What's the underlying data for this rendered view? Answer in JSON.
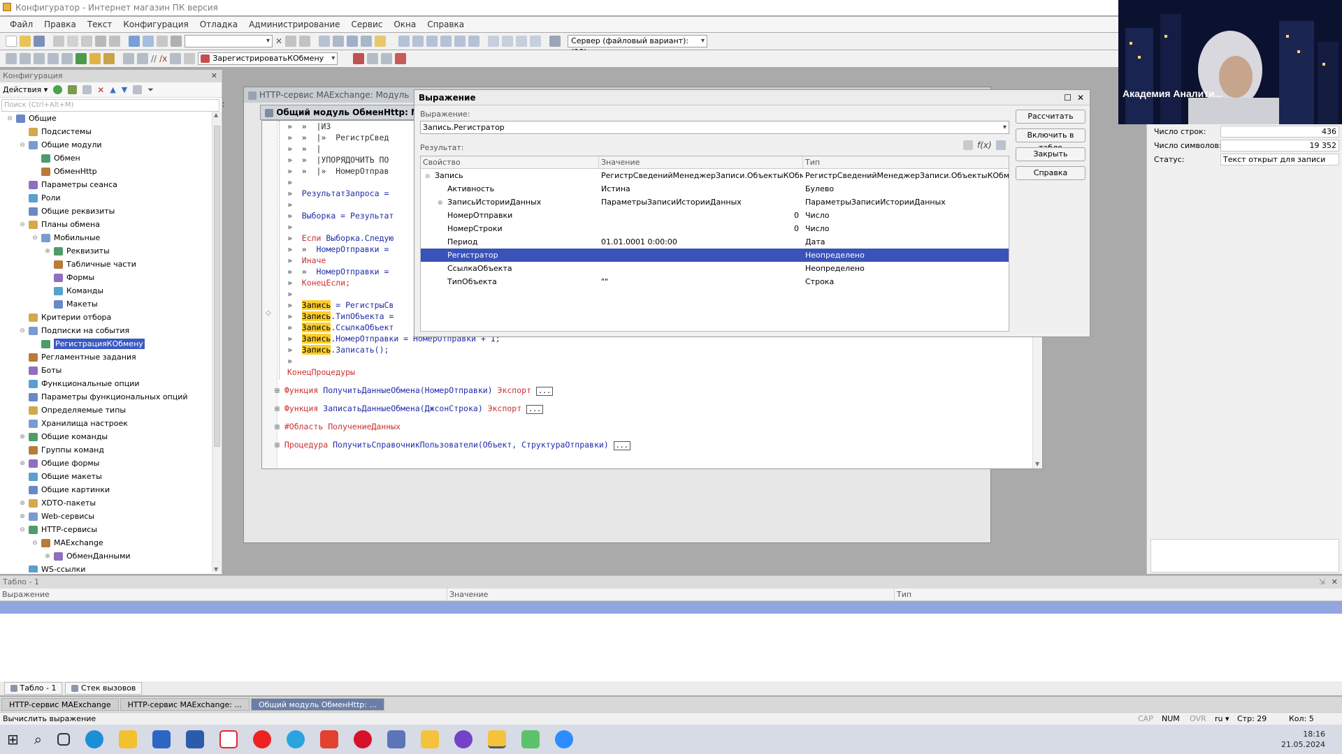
{
  "app": {
    "title": "Конфигуратор - Интернет магазин ПК версия",
    "menu": [
      "Файл",
      "Правка",
      "Текст",
      "Конфигурация",
      "Отладка",
      "Администрирование",
      "Сервис",
      "Окна",
      "Справка"
    ],
    "server_combo": "Сервер (файловый вариант): (10)",
    "proc_combo": "ЗарегистрироватьКОбмену"
  },
  "config_panel": {
    "title": "Конфигурация",
    "actions_label": "Действия",
    "search_placeholder": "Поиск (Ctrl+Alt+M)",
    "tree": [
      {
        "label": "Общие",
        "level": 0,
        "twisty": "⊖"
      },
      {
        "label": "Подсистемы",
        "level": 1,
        "twisty": ""
      },
      {
        "label": "Общие модули",
        "level": 1,
        "twisty": "⊖"
      },
      {
        "label": "Обмен",
        "level": 2,
        "twisty": ""
      },
      {
        "label": "ОбменHttp",
        "level": 2,
        "twisty": ""
      },
      {
        "label": "Параметры сеанса",
        "level": 1,
        "twisty": ""
      },
      {
        "label": "Роли",
        "level": 1,
        "twisty": ""
      },
      {
        "label": "Общие реквизиты",
        "level": 1,
        "twisty": ""
      },
      {
        "label": "Планы обмена",
        "level": 1,
        "twisty": "⊖"
      },
      {
        "label": "Мобильные",
        "level": 2,
        "twisty": "⊖"
      },
      {
        "label": "Реквизиты",
        "level": 3,
        "twisty": "⊕"
      },
      {
        "label": "Табличные части",
        "level": 3,
        "twisty": ""
      },
      {
        "label": "Формы",
        "level": 3,
        "twisty": ""
      },
      {
        "label": "Команды",
        "level": 3,
        "twisty": ""
      },
      {
        "label": "Макеты",
        "level": 3,
        "twisty": ""
      },
      {
        "label": "Критерии отбора",
        "level": 1,
        "twisty": ""
      },
      {
        "label": "Подписки на события",
        "level": 1,
        "twisty": "⊖"
      },
      {
        "label": "РегистрацияКОбмену",
        "level": 2,
        "twisty": "",
        "selected": true
      },
      {
        "label": "Регламентные задания",
        "level": 1,
        "twisty": ""
      },
      {
        "label": "Боты",
        "level": 1,
        "twisty": ""
      },
      {
        "label": "Функциональные опции",
        "level": 1,
        "twisty": ""
      },
      {
        "label": "Параметры функциональных опций",
        "level": 1,
        "twisty": ""
      },
      {
        "label": "Определяемые типы",
        "level": 1,
        "twisty": ""
      },
      {
        "label": "Хранилища настроек",
        "level": 1,
        "twisty": ""
      },
      {
        "label": "Общие команды",
        "level": 1,
        "twisty": "⊕"
      },
      {
        "label": "Группы команд",
        "level": 1,
        "twisty": ""
      },
      {
        "label": "Общие формы",
        "level": 1,
        "twisty": "⊕"
      },
      {
        "label": "Общие макеты",
        "level": 1,
        "twisty": ""
      },
      {
        "label": "Общие картинки",
        "level": 1,
        "twisty": ""
      },
      {
        "label": "XDTO-пакеты",
        "level": 1,
        "twisty": "⊕"
      },
      {
        "label": "Web-сервисы",
        "level": 1,
        "twisty": "⊕"
      },
      {
        "label": "HTTP-сервисы",
        "level": 1,
        "twisty": "⊖"
      },
      {
        "label": "MAExchange",
        "level": 2,
        "twisty": "⊖"
      },
      {
        "label": "ОбменДанными",
        "level": 3,
        "twisty": "⊕"
      },
      {
        "label": "WS-ссылки",
        "level": 1,
        "twisty": ""
      }
    ]
  },
  "bg_window_title": "HTTP-сервис MAExchange: Модуль",
  "module_window_title": "Общий модуль ОбменHttp: Модул",
  "code_lines": [
    [
      {
        "t": "»  »  |ИЗ",
        "c": "cg"
      }
    ],
    [
      {
        "t": "»  »  |»  РегистрСвед",
        "c": "cg"
      }
    ],
    [
      {
        "t": "»  »  |",
        "c": "cg"
      }
    ],
    [
      {
        "t": "»  »  |УПОРЯДОЧИТЬ ПО",
        "c": "cg"
      }
    ],
    [
      {
        "t": "»  »  |»  НомерОтправ",
        "c": "cg"
      }
    ],
    [
      {
        "t": "»",
        "c": "cg"
      }
    ],
    [
      {
        "t": "»  ",
        "c": "cg"
      },
      {
        "t": "РезультатЗапроса = ",
        "c": "id"
      }
    ],
    [
      {
        "t": "»",
        "c": "cg"
      }
    ],
    [
      {
        "t": "»  ",
        "c": "cg"
      },
      {
        "t": "Выборка = Результат",
        "c": "id"
      }
    ],
    [
      {
        "t": "»",
        "c": "cg"
      }
    ],
    [
      {
        "t": "»  ",
        "c": "cg"
      },
      {
        "t": "Если",
        "c": "kw"
      },
      {
        "t": " Выборка.Следую",
        "c": "id"
      }
    ],
    [
      {
        "t": "»  »  ",
        "c": "cg"
      },
      {
        "t": "НомерОтправки =",
        "c": "id"
      }
    ],
    [
      {
        "t": "»  ",
        "c": "cg"
      },
      {
        "t": "Иначе",
        "c": "kw"
      }
    ],
    [
      {
        "t": "»  »  ",
        "c": "cg"
      },
      {
        "t": "НомерОтправки =",
        "c": "id"
      }
    ],
    [
      {
        "t": "»  ",
        "c": "cg"
      },
      {
        "t": "КонецЕсли;",
        "c": "kw"
      }
    ],
    [
      {
        "t": "»",
        "c": "cg"
      }
    ],
    [
      {
        "t": "»  ",
        "c": "cg"
      },
      {
        "t": "Запись",
        "c": "hl"
      },
      {
        "t": " = РегистрыСв",
        "c": "id"
      }
    ],
    [
      {
        "t": "»  ",
        "c": "cg"
      },
      {
        "t": "Запись",
        "c": "hl"
      },
      {
        "t": ".ТипОбъекта =",
        "c": "id"
      }
    ],
    [
      {
        "t": "»  ",
        "c": "cg"
      },
      {
        "t": "Запись",
        "c": "hl"
      },
      {
        "t": ".СсылкаОбъект",
        "c": "id"
      }
    ],
    [
      {
        "t": "»  ",
        "c": "cg"
      },
      {
        "t": "Запись",
        "c": "hl"
      },
      {
        "t": ".НомерОтправки = НомерОтправки + 1;",
        "c": "id"
      }
    ],
    [
      {
        "t": "»  ",
        "c": "cg"
      },
      {
        "t": "Запись",
        "c": "hl"
      },
      {
        "t": ".Записать();",
        "c": "id"
      }
    ],
    [
      {
        "t": "»",
        "c": "cg"
      }
    ],
    [
      {
        "t": "КонецПроцедуры",
        "c": "kw"
      }
    ]
  ],
  "code_functions": [
    {
      "kw": "Функция",
      "sig": "ПолучитьДанныеОбмена(НомерОтправки)",
      "ex": "Экспорт",
      "box": "..."
    },
    {
      "kw": "Функция",
      "sig": "ЗаписатьДанныеОбмена(ДжсонСтрока)",
      "ex": "Экспорт",
      "box": "..."
    },
    {
      "kw": "#Область",
      "sig": "ПолучениеДанных",
      "ex": "",
      "box": ""
    },
    {
      "kw": "Процедура",
      "sig": "ПолучитьСправочникПользователи(Объект, СтруктураОтправки)",
      "ex": "",
      "box": "..."
    }
  ],
  "expression_dialog": {
    "title": "Выражение",
    "expr_label": "Выражение:",
    "expr_value": "Запись.Регистратор",
    "result_label": "Результат:",
    "buttons": [
      "Рассчитать",
      "Включить в табло",
      "Закрыть",
      "Справка"
    ],
    "columns": [
      "Свойство",
      "Значение",
      "Тип"
    ],
    "rows": [
      {
        "prop": "Запись",
        "val": "РегистрСведенийМенеджерЗаписи.ОбъектыКОбмену",
        "type": "РегистрСведенийМенеджерЗаписи.ОбъектыКОбмену",
        "indent": 0,
        "twisty": "⊖"
      },
      {
        "prop": "Активность",
        "val": "Истина",
        "type": "Булево",
        "indent": 1,
        "twisty": ""
      },
      {
        "prop": "ЗаписьИсторииДанных",
        "val": "ПараметрыЗаписиИсторииДанных",
        "type": "ПараметрыЗаписиИсторииДанных",
        "indent": 1,
        "twisty": "⊕"
      },
      {
        "prop": "НомерОтправки",
        "val": "0",
        "type": "Число",
        "indent": 1,
        "twisty": "",
        "num": true
      },
      {
        "prop": "НомерСтроки",
        "val": "0",
        "type": "Число",
        "indent": 1,
        "twisty": "",
        "num": true
      },
      {
        "prop": "Период",
        "val": "01.01.0001 0:00:00",
        "type": "Дата",
        "indent": 1,
        "twisty": ""
      },
      {
        "prop": "Регистратор",
        "val": "",
        "type": "Неопределено",
        "indent": 1,
        "twisty": "",
        "selected": true
      },
      {
        "prop": "СсылкаОбъекта",
        "val": "",
        "type": "Неопределено",
        "indent": 1,
        "twisty": ""
      },
      {
        "prop": "ТипОбъекта",
        "val": "\"\"",
        "type": "Строка",
        "indent": 1,
        "twisty": ""
      }
    ]
  },
  "props_panel": {
    "rows_label": "Число строк:",
    "rows_value": "436",
    "chars_label": "Число символов:",
    "chars_value": "19 352",
    "status_label": "Статус:",
    "status_value": "Текст открыт для записи"
  },
  "tablo": {
    "title": "Табло - 1",
    "columns": [
      "Выражение",
      "Значение",
      "Тип"
    ]
  },
  "bottom_tabs": [
    "Табло - 1",
    "Стек вызовов"
  ],
  "window_tabs": [
    "HTTP-сервис MAExchange",
    "HTTP-сервис MAExchange: ...",
    "Общий модуль ОбменHttp: ..."
  ],
  "statusbar": {
    "text": "Вычислить выражение",
    "cap": "CAP",
    "num": "NUM",
    "ovr": "OVR",
    "lang": "ru",
    "line": "Стр: 29",
    "col": "Кол: 5"
  },
  "video": {
    "caption": "Академия Аналити..."
  },
  "clock": {
    "time": "18:16",
    "date": "21.05.2024"
  }
}
